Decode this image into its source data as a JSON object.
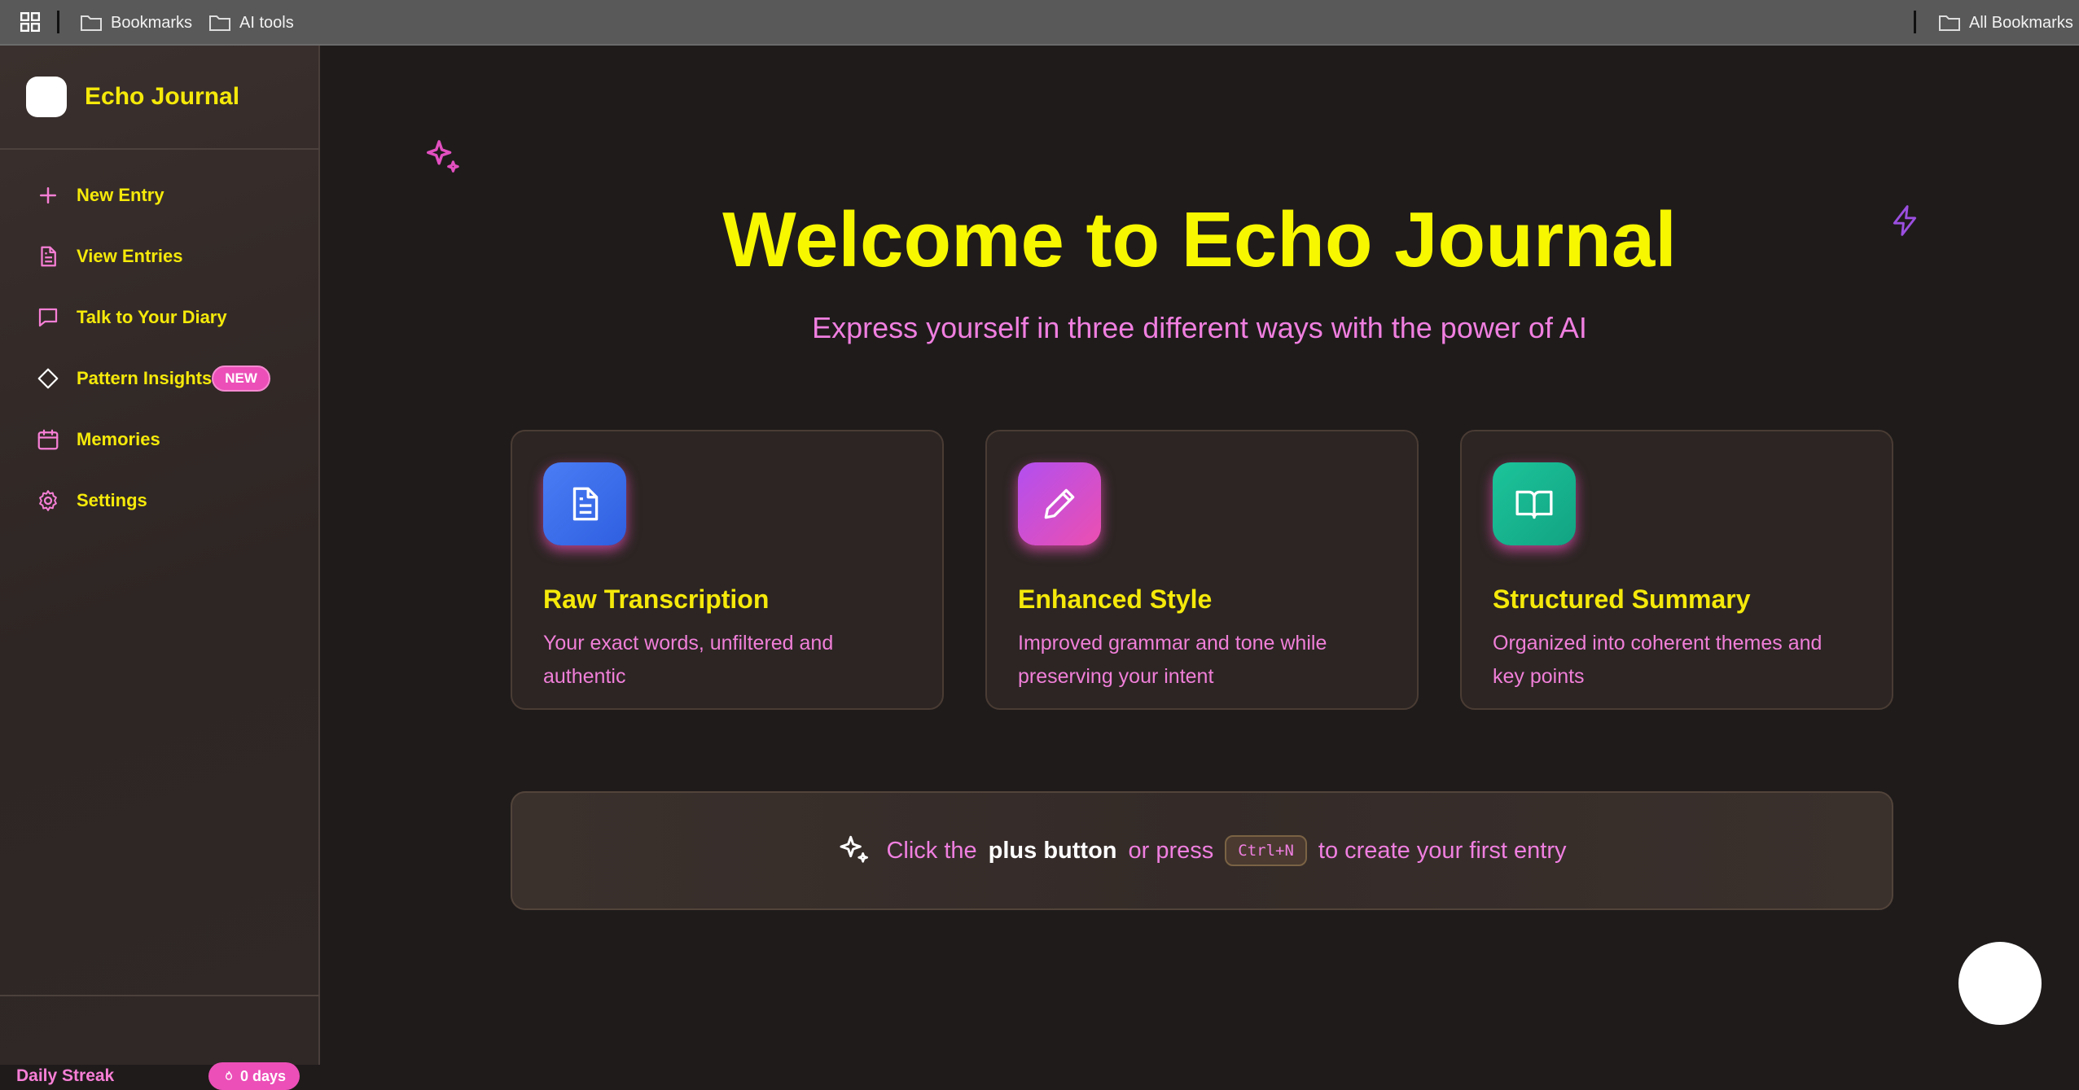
{
  "bookmarks_bar": {
    "items": [
      "Bookmarks",
      "AI tools"
    ],
    "all_bookmarks": "All Bookmarks"
  },
  "sidebar": {
    "app_name": "Echo Journal",
    "nav": [
      {
        "label": "New Entry",
        "icon": "plus-icon"
      },
      {
        "label": "View Entries",
        "icon": "document-icon"
      },
      {
        "label": "Talk to Your Diary",
        "icon": "chat-icon"
      },
      {
        "label": "Pattern Insights",
        "icon": "diamond-icon",
        "badge": "NEW"
      },
      {
        "label": "Memories",
        "icon": "calendar-icon"
      },
      {
        "label": "Settings",
        "icon": "gear-icon"
      }
    ],
    "streak": {
      "label": "Daily Streak",
      "value": "0 days",
      "icon": "flame-icon"
    }
  },
  "main": {
    "title": "Welcome to Echo Journal",
    "subtitle": "Express yourself in three different ways with the power of AI",
    "cards": [
      {
        "title": "Raw Transcription",
        "desc": "Your exact words, unfiltered and authentic",
        "icon": "document-icon",
        "color": "#3b6ff0"
      },
      {
        "title": "Enhanced Style",
        "desc": "Improved grammar and tone while preserving your intent",
        "icon": "pencil-icon",
        "color": "#c44fe8"
      },
      {
        "title": "Structured Summary",
        "desc": "Organized into coherent themes and key points",
        "icon": "book-icon",
        "color": "#17b58f"
      }
    ],
    "hint": {
      "prefix": "Click the",
      "strong": "plus button",
      "middle": "or press",
      "shortcut": "Ctrl+N",
      "suffix": "to create your first entry"
    }
  },
  "colors": {
    "accent_yellow": "#f5e90a",
    "accent_pink": "#f07fe0",
    "background": "#1f1b1b"
  }
}
